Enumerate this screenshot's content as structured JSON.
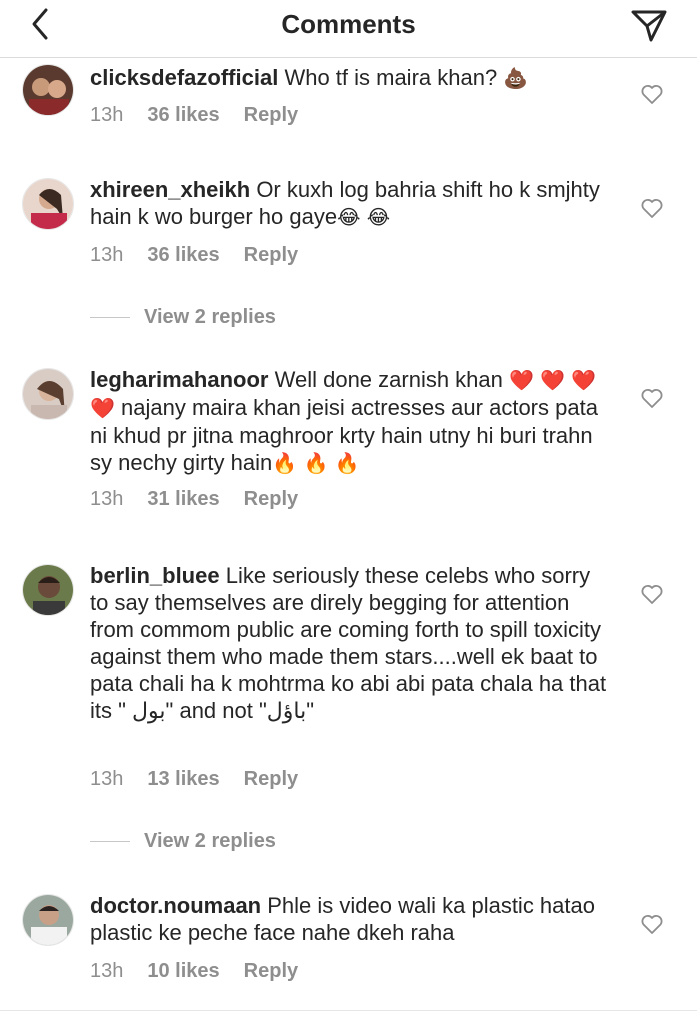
{
  "header": {
    "title": "Comments"
  },
  "comments": [
    {
      "username": "clicksdefazofficial",
      "text": "Who tf is maira khan?",
      "emoji": "💩",
      "time": "13h",
      "likes": "36 likes",
      "reply": "Reply"
    },
    {
      "username": "xhireen_xheikh",
      "text": "Or kuxh log bahria shift ho k smjhty hain k wo burger ho gaye",
      "emoji": "😂 😂",
      "time": "13h",
      "likes": "36 likes",
      "reply": "Reply",
      "view_replies": "View 2 replies"
    },
    {
      "username": "legharimahanoor",
      "text_1": "Well done zarnish khan",
      "emoji_1": "❤️",
      "emoji_2": "❤️ ❤️ ❤️",
      "text_2": "najany maira khan jeisi actresses aur actors  pata ni khud pr jitna maghroor krty hain utny hi buri trahn sy nechy girty hain",
      "emoji_3": "🔥 🔥 🔥",
      "time": "13h",
      "likes": "31 likes",
      "reply": "Reply"
    },
    {
      "username": "berlin_bluee",
      "text": "Like seriously these celebs who sorry to say themselves are direly begging for attention from commom public are coming forth to spill toxicity against them who made them stars....well ek baat to pata chali ha k mohtrma ko abi abi pata chala ha that its \" بول\" and not \"باؤل\"",
      "time": "13h",
      "likes": "13 likes",
      "reply": "Reply",
      "view_replies": "View 2 replies"
    },
    {
      "username": "doctor.noumaan",
      "text": "Phle is video wali ka plastic hatao plastic ke peche face nahe dkeh raha",
      "time": "13h",
      "likes": "10 likes",
      "reply": "Reply"
    }
  ]
}
